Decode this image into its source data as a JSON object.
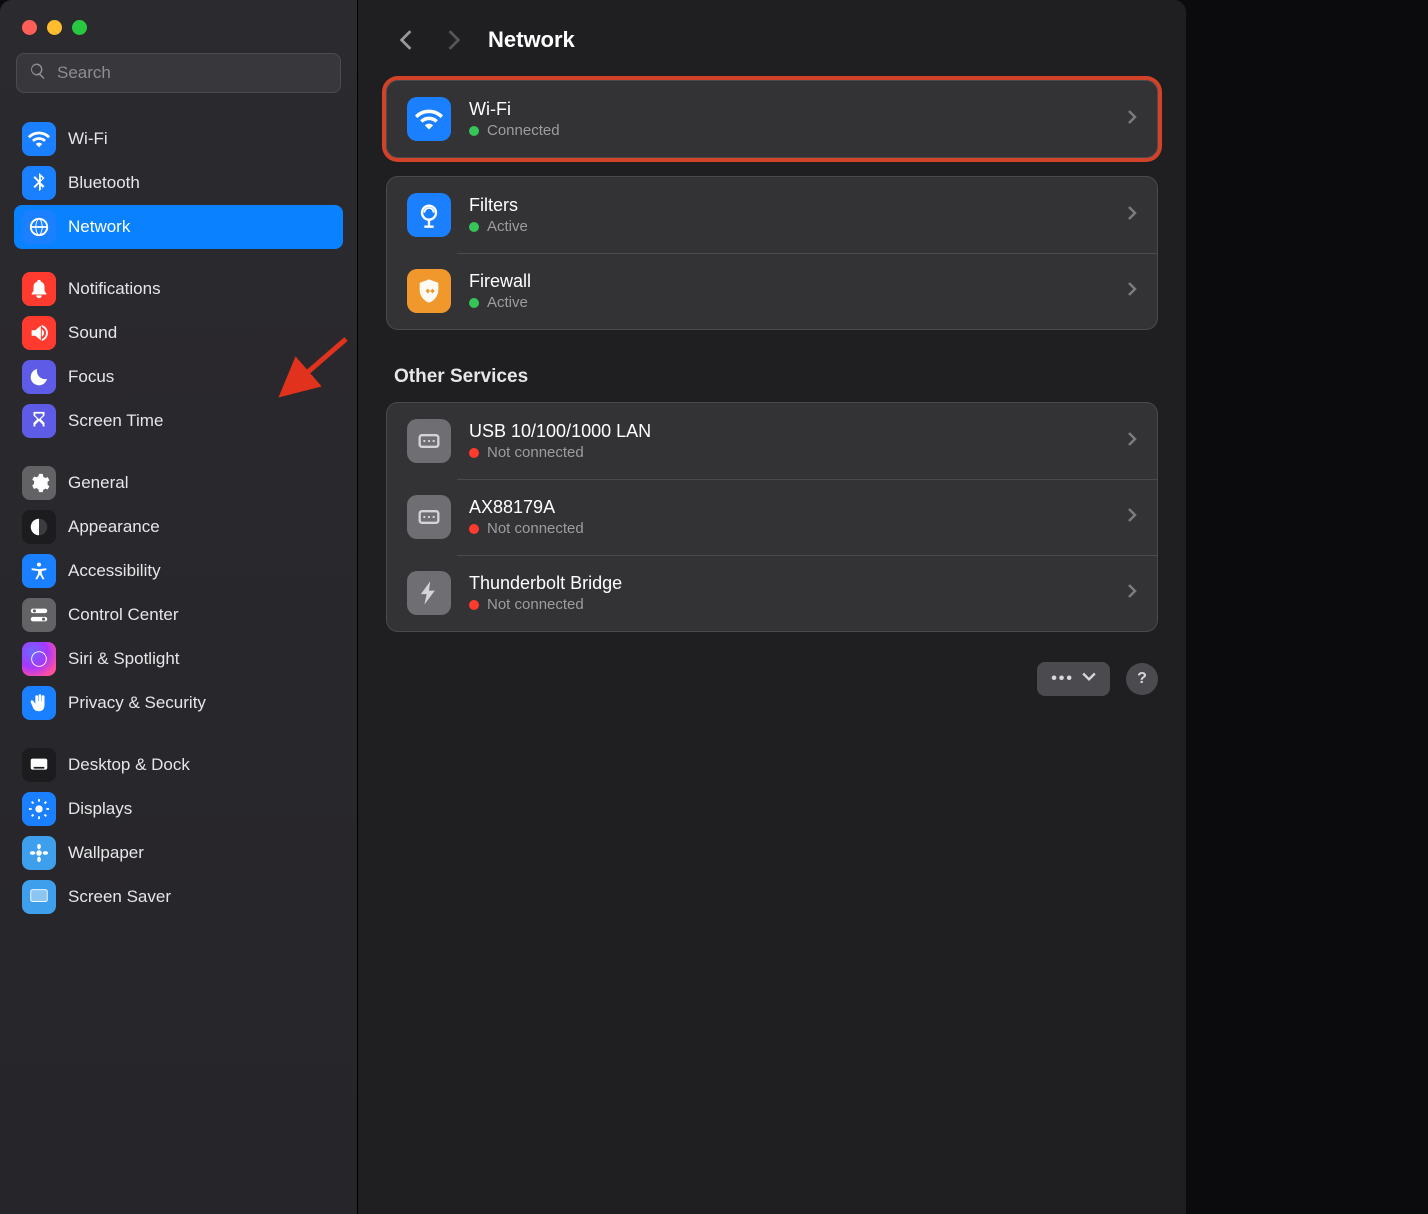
{
  "window": {
    "title": "Network"
  },
  "search": {
    "placeholder": "Search"
  },
  "sidebar": {
    "groups": [
      {
        "items": [
          {
            "id": "wifi",
            "label": "Wi-Fi"
          },
          {
            "id": "bluetooth",
            "label": "Bluetooth"
          },
          {
            "id": "network",
            "label": "Network",
            "selected": true
          }
        ]
      },
      {
        "items": [
          {
            "id": "notifications",
            "label": "Notifications"
          },
          {
            "id": "sound",
            "label": "Sound"
          },
          {
            "id": "focus",
            "label": "Focus"
          },
          {
            "id": "screen-time",
            "label": "Screen Time"
          }
        ]
      },
      {
        "items": [
          {
            "id": "general",
            "label": "General"
          },
          {
            "id": "appearance",
            "label": "Appearance"
          },
          {
            "id": "accessibility",
            "label": "Accessibility"
          },
          {
            "id": "control-center",
            "label": "Control Center"
          },
          {
            "id": "siri-spotlight",
            "label": "Siri & Spotlight"
          },
          {
            "id": "privacy-security",
            "label": "Privacy & Security"
          }
        ]
      },
      {
        "items": [
          {
            "id": "desktop-dock",
            "label": "Desktop & Dock"
          },
          {
            "id": "displays",
            "label": "Displays"
          },
          {
            "id": "wallpaper",
            "label": "Wallpaper"
          },
          {
            "id": "screen-saver",
            "label": "Screen Saver"
          }
        ]
      }
    ]
  },
  "main": {
    "services": [
      {
        "id": "wifi",
        "title": "Wi-Fi",
        "status": "Connected",
        "statusColor": "green",
        "highlight": true
      }
    ],
    "services2": [
      {
        "id": "filters",
        "title": "Filters",
        "status": "Active",
        "statusColor": "green"
      },
      {
        "id": "firewall",
        "title": "Firewall",
        "status": "Active",
        "statusColor": "green"
      }
    ],
    "other_label": "Other Services",
    "other": [
      {
        "id": "usb-lan",
        "title": "USB 10/100/1000 LAN",
        "status": "Not connected",
        "statusColor": "red"
      },
      {
        "id": "ax88179a",
        "title": "AX88179A",
        "status": "Not connected",
        "statusColor": "red"
      },
      {
        "id": "thunderbolt-bridge",
        "title": "Thunderbolt Bridge",
        "status": "Not connected",
        "statusColor": "red"
      }
    ]
  },
  "footer": {
    "more": "...",
    "help": "?"
  }
}
